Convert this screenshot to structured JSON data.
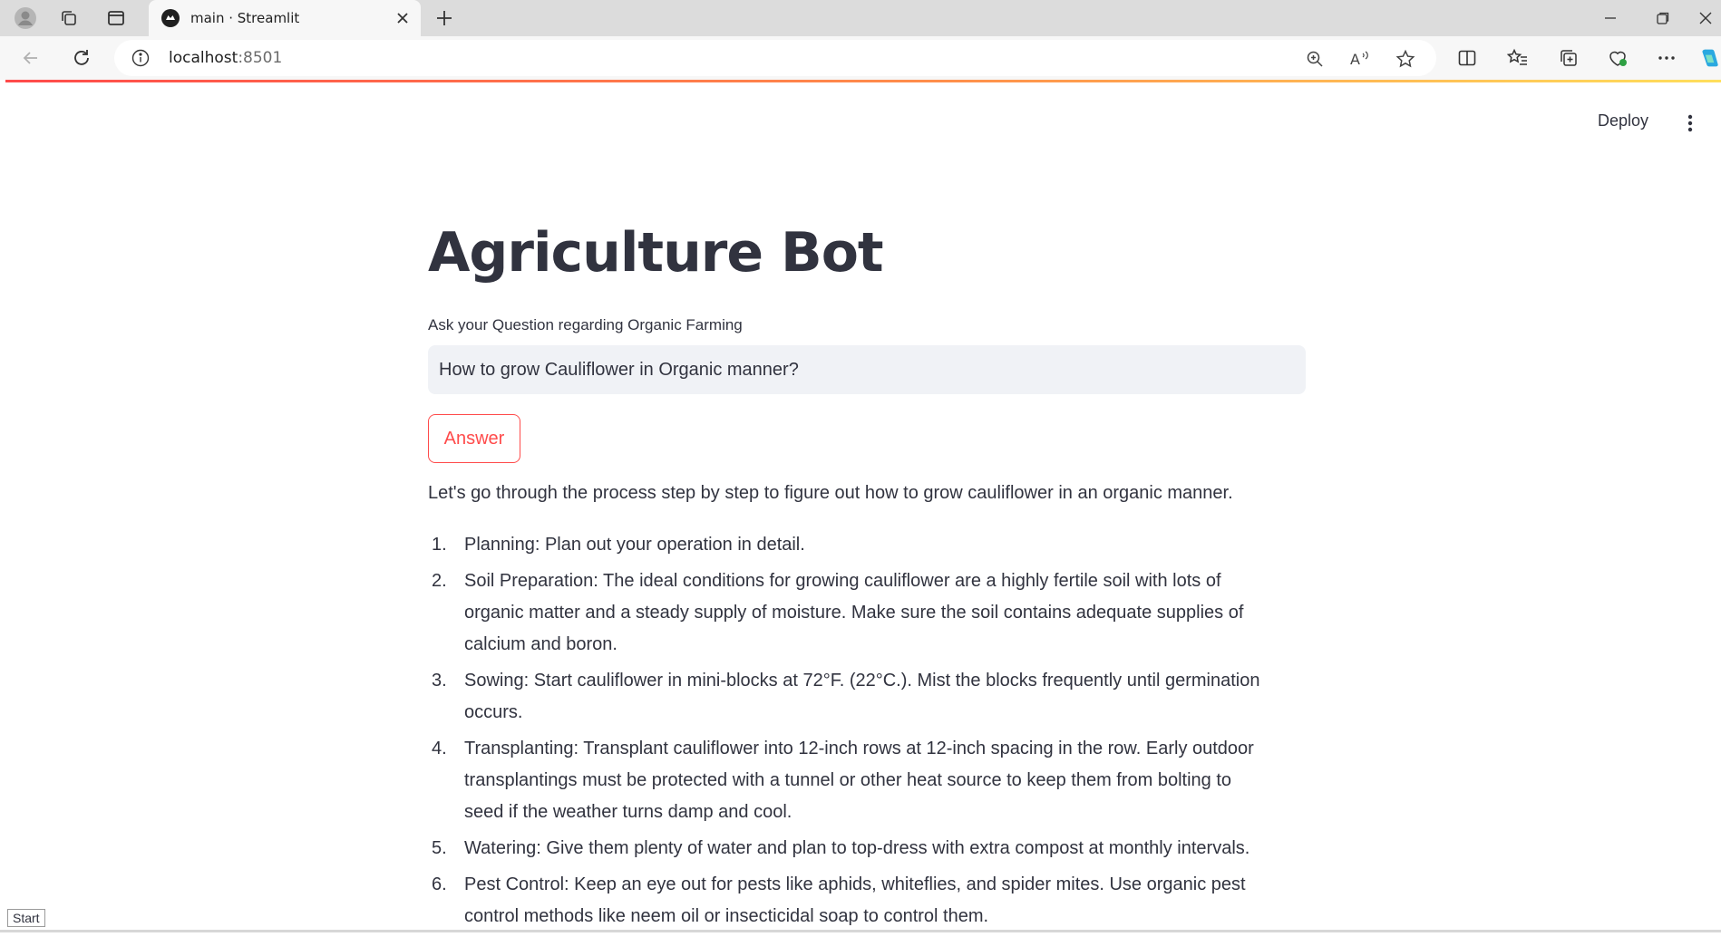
{
  "browser": {
    "tab_title": "main · Streamlit",
    "url_host": "localhost",
    "url_port": ":8501"
  },
  "app": {
    "deploy_label": "Deploy",
    "title": "Agriculture Bot",
    "input_label": "Ask your Question regarding Organic Farming",
    "input_value": "How to grow Cauliflower in Organic manner?",
    "answer_button": "Answer",
    "intro": "Let's go through the process step by step to figure out how to grow cauliflower in an organic manner.",
    "steps": [
      {
        "num": "1.",
        "lines": [
          "Planning: Plan out your operation in detail."
        ]
      },
      {
        "num": "2.",
        "lines": [
          "Soil Preparation: The ideal conditions for growing cauliflower are a highly fertile soil with lots of",
          "organic matter and a steady supply of moisture. Make sure the soil contains adequate supplies of",
          "calcium and boron."
        ]
      },
      {
        "num": "3.",
        "lines": [
          "Sowing: Start cauliflower in mini-blocks at 72°F. (22°C.). Mist the blocks frequently until germination",
          "occurs."
        ]
      },
      {
        "num": "4.",
        "lines": [
          "Transplanting: Transplant cauliflower into 12-inch rows at 12-inch spacing in the row. Early outdoor",
          "transplantings must be protected with a tunnel or other heat source to keep them from bolting to",
          "seed if the weather turns damp and cool."
        ]
      },
      {
        "num": "5.",
        "lines": [
          "Watering: Give them plenty of water and plan to top-dress with extra compost at monthly intervals."
        ]
      },
      {
        "num": "6.",
        "lines": [
          "Pest Control: Keep an eye out for pests like aphids, whiteflies, and spider mites. Use organic pest",
          "control methods like neem oil or insecticidal soap to control them."
        ]
      }
    ]
  },
  "taskbar": {
    "start_label": "Start"
  },
  "colors": {
    "accent": "#ff4b4b",
    "text": "#31333f",
    "input_bg": "#f0f2f6"
  }
}
